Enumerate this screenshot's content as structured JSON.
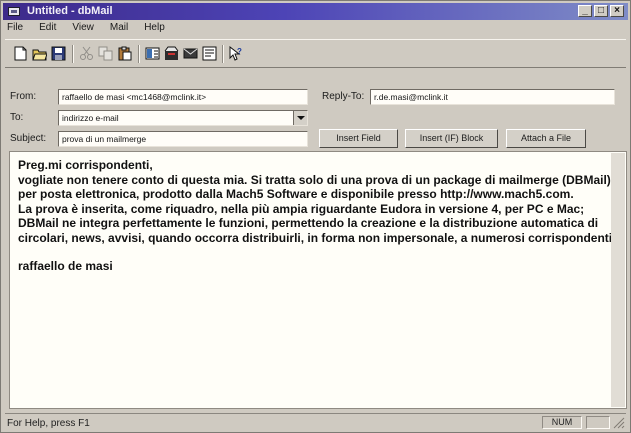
{
  "window": {
    "title": "Untitled - dbMail",
    "minimize": "_",
    "maximize": "□",
    "close": "×"
  },
  "menu": [
    "File",
    "Edit",
    "View",
    "Mail",
    "Help"
  ],
  "toolbar_icons": [
    "new-document-icon",
    "open-folder-icon",
    "save-icon",
    "cut-icon",
    "copy-icon",
    "paste-icon",
    "address-book-icon",
    "mailbox-icon",
    "send-icon",
    "properties-icon",
    "context-help-icon"
  ],
  "header": {
    "from_label": "From:",
    "from_value": "raffaello de masi <mc1468@mclink.it>",
    "replyto_label": "Reply-To:",
    "replyto_value": "r.de.masi@mclink.it",
    "to_label": "To:",
    "to_value": "indirizzo e-mail",
    "subject_label": "Subject:",
    "subject_value": "prova di un mailmerge"
  },
  "buttons": {
    "insert_field": "Insert Field",
    "insert_if": "Insert (IF) Block",
    "attach": "Attach a File"
  },
  "message": {
    "lines": [
      "Preg.mi corrispondenti,",
      "vogliate non tenere conto di questa mia. Si tratta solo di una prova di un package di mailmerge (DBMail) per posta elettronica, prodotto dalla Mach5 Software e disponibile presso http://www.mach5.com.",
      "La prova è inserita, come riquadro, nella più ampia riguardante Eudora in versione 4, per PC e Mac; DBMail ne integra perfettamente le funzioni, permettendo la creazione e la distribuzione automatica di circolari, news, avvisi, quando occorra distribuirli, in forma non impersonale, a numerosi corrispondenti.",
      "",
      "raffaello de masi"
    ]
  },
  "status": {
    "help_text": "For Help, press F1",
    "num": "NUM"
  }
}
